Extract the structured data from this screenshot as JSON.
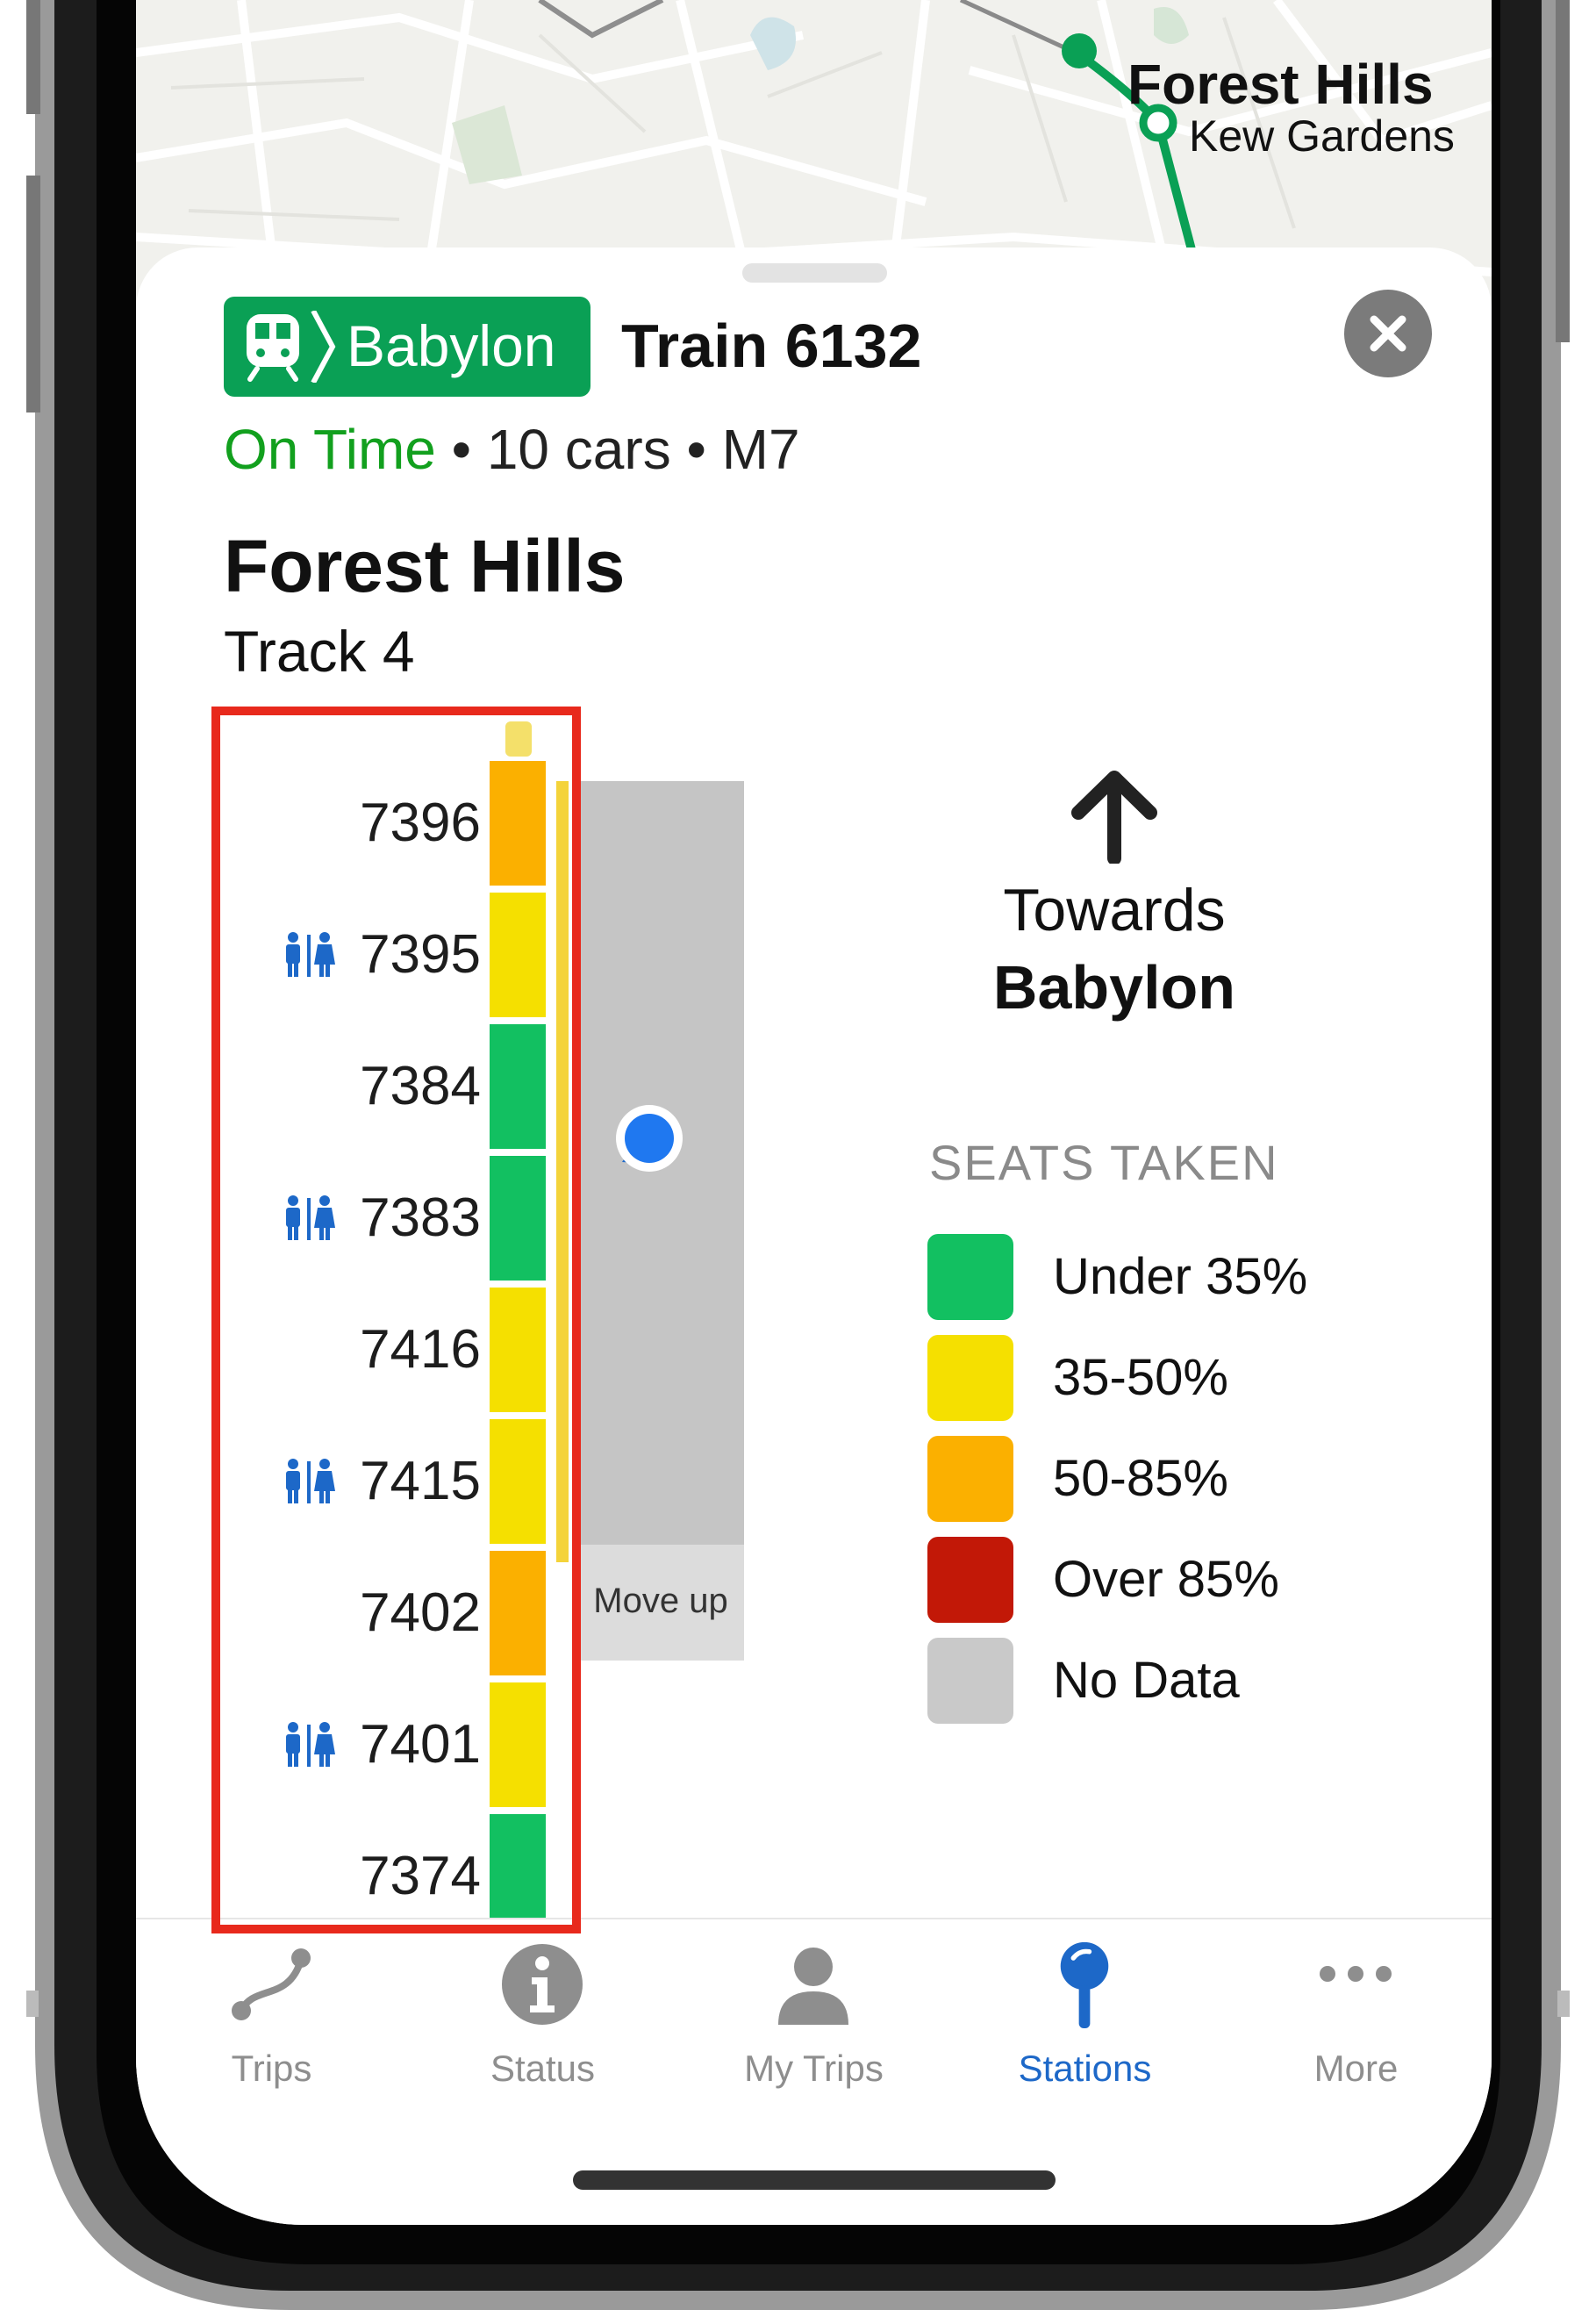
{
  "map": {
    "station_primary": "Forest Hills",
    "station_secondary": "Kew Gardens",
    "line_color": "#0aa055"
  },
  "train": {
    "route_icon": "train-icon",
    "route_name": "Babylon",
    "title": "Train 6132",
    "status": "On Time",
    "details": "• 10 cars • M7",
    "status_color": "#12a01e"
  },
  "station": {
    "name": "Forest Hills",
    "track": "Track 4"
  },
  "cars": [
    {
      "number": "7396",
      "restroom": false,
      "level": "50-85%",
      "color": "#fbb000"
    },
    {
      "number": "7395",
      "restroom": true,
      "level": "35-50%",
      "color": "#f5e000"
    },
    {
      "number": "7384",
      "restroom": false,
      "level": "Under 35%",
      "color": "#12c061"
    },
    {
      "number": "7383",
      "restroom": true,
      "level": "Under 35%",
      "color": "#12c061"
    },
    {
      "number": "7416",
      "restroom": false,
      "level": "35-50%",
      "color": "#f5e000"
    },
    {
      "number": "7415",
      "restroom": true,
      "level": "35-50%",
      "color": "#f5e000"
    },
    {
      "number": "7402",
      "restroom": false,
      "level": "50-85%",
      "color": "#fbb000"
    },
    {
      "number": "7401",
      "restroom": true,
      "level": "35-50%",
      "color": "#f5e000"
    },
    {
      "number": "7374",
      "restroom": false,
      "level": "Under 35%",
      "color": "#12c061"
    }
  ],
  "platform": {
    "label": "Move up",
    "location_icon": "user-location-icon"
  },
  "direction": {
    "arrow_icon": "arrow-up-icon",
    "towards_label": "Towards",
    "destination": "Babylon"
  },
  "legend": {
    "title": "SEATS TAKEN",
    "items": [
      {
        "label": "Under 35%",
        "color": "#12c061"
      },
      {
        "label": "35-50%",
        "color": "#f5e000"
      },
      {
        "label": "50-85%",
        "color": "#fbb000"
      },
      {
        "label": "Over 85%",
        "color": "#c21807"
      },
      {
        "label": "No Data",
        "color": "#c9c9c9"
      }
    ]
  },
  "tabs": [
    {
      "label": "Trips",
      "icon": "route-icon",
      "active": false
    },
    {
      "label": "Status",
      "icon": "info-icon",
      "active": false
    },
    {
      "label": "My Trips",
      "icon": "person-icon",
      "active": false
    },
    {
      "label": "Stations",
      "icon": "pin-icon",
      "active": true
    },
    {
      "label": "More",
      "icon": "ellipsis-icon",
      "active": false
    }
  ]
}
